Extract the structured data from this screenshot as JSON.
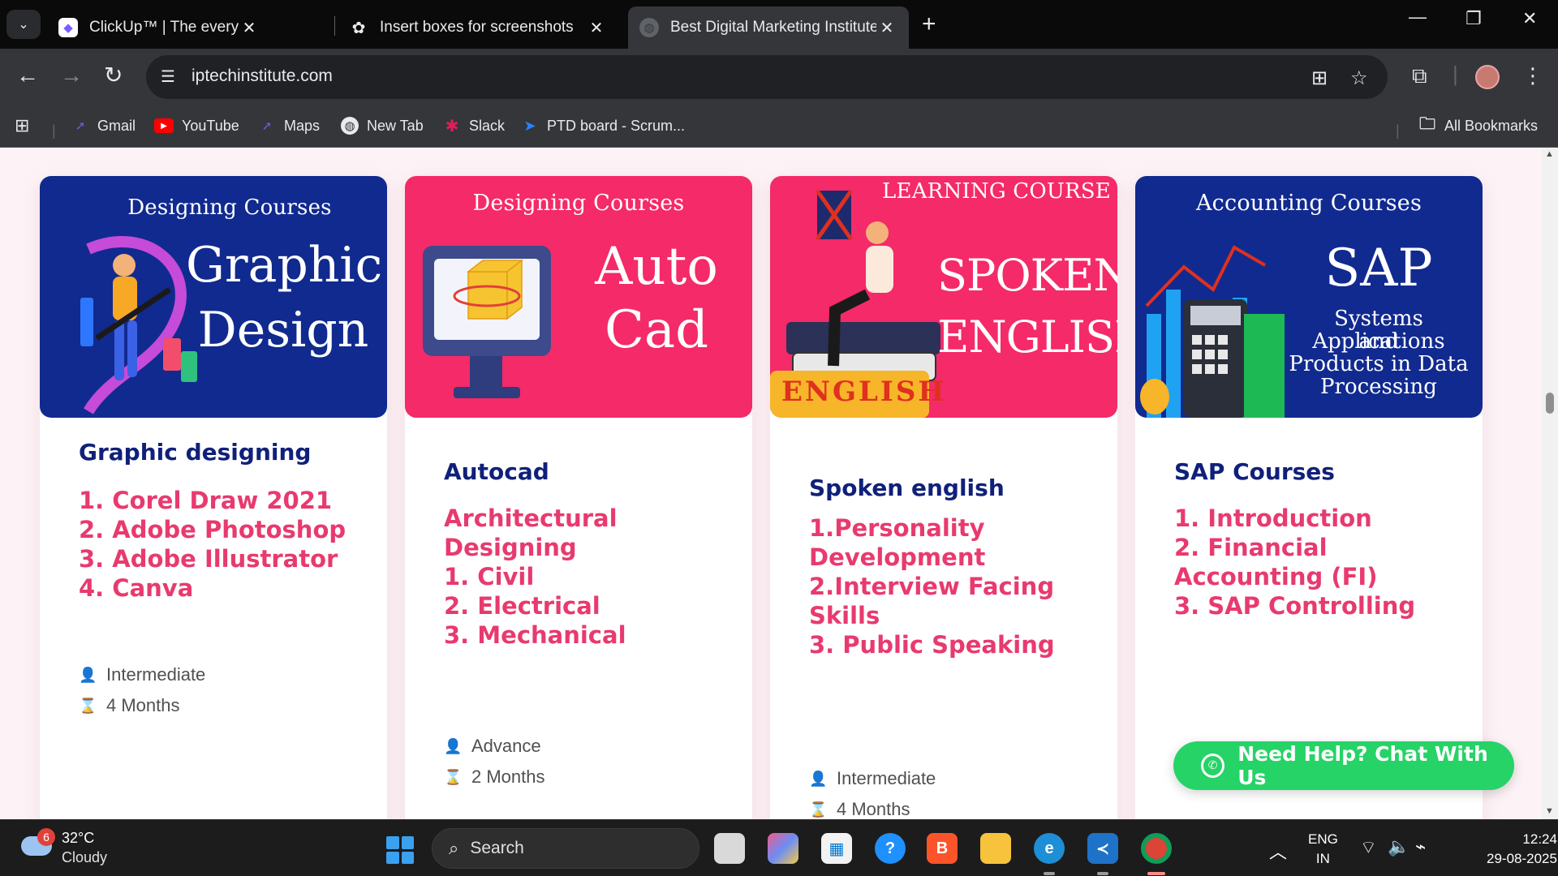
{
  "browser": {
    "tabs": [
      {
        "title": "ClickUp™ | The everything app f",
        "icon": "clickup-icon",
        "active": false
      },
      {
        "title": "Insert boxes for screenshots",
        "icon": "chatgpt-icon",
        "active": false
      },
      {
        "title": "Best Digital Marketing Institute",
        "icon": "globe-icon",
        "active": true
      }
    ],
    "url": "iptechinstitute.com",
    "bookmarks": [
      {
        "label": "Gmail",
        "icon": "gmail-icon"
      },
      {
        "label": "YouTube",
        "icon": "youtube-icon"
      },
      {
        "label": "Maps",
        "icon": "maps-icon"
      },
      {
        "label": "New Tab",
        "icon": "globe-icon"
      },
      {
        "label": "Slack",
        "icon": "slack-icon"
      },
      {
        "label": "PTD board - Scrum...",
        "icon": "jira-icon"
      }
    ],
    "all_bookmarks": "All Bookmarks"
  },
  "courses": [
    {
      "banner_sub": "Designing Courses",
      "banner_title_1": "Graphic",
      "banner_title_2": "Design",
      "banner_color": "#112a8f",
      "title": "Graphic designing",
      "items": [
        "1. Corel Draw 2021",
        "2. Adobe Photoshop",
        "3. Adobe Illustrator",
        "4. Canva"
      ],
      "level": "Intermediate",
      "duration": "4 Months"
    },
    {
      "banner_sub": "Designing Courses",
      "banner_title_1": "Auto",
      "banner_title_2": "Cad",
      "banner_color": "#f52a68",
      "title": "Autocad",
      "items": [
        "Architectural",
        "Designing",
        "1. Civil",
        "2. Electrical",
        "3. Mechanical"
      ],
      "level": "Advance",
      "duration": "2 Months"
    },
    {
      "banner_sub": "LEARNING COURSE",
      "banner_title_1": "SPOKEN",
      "banner_title_2": "ENGLISH",
      "banner_badge": "ENGLISH",
      "banner_color": "#f52a68",
      "title": "Spoken english",
      "items": [
        "1.Personality",
        "Development",
        "2.Interview Facing",
        "Skills",
        "3. Public Speaking"
      ],
      "level": "Intermediate",
      "duration": "4 Months"
    },
    {
      "banner_sub": "Accounting Courses",
      "banner_title_1": "SAP",
      "banner_title_2": "Systems Applications",
      "banner_title_3": "and",
      "banner_title_4": "Products in Data",
      "banner_title_5": "Processing",
      "banner_color": "#112a8f",
      "title": "SAP Courses",
      "items": [
        "1. Introduction",
        "2. Financial",
        "Accounting (FI)",
        "3. SAP Controlling"
      ]
    }
  ],
  "chat_button": "Need Help? Chat With Us",
  "taskbar": {
    "weather_temp": "32°C",
    "weather_cond": "Cloudy",
    "weather_badge": "6",
    "search_label": "Search",
    "lang_1": "ENG",
    "lang_2": "IN",
    "time": "12:24",
    "date": "29-08-2025"
  }
}
